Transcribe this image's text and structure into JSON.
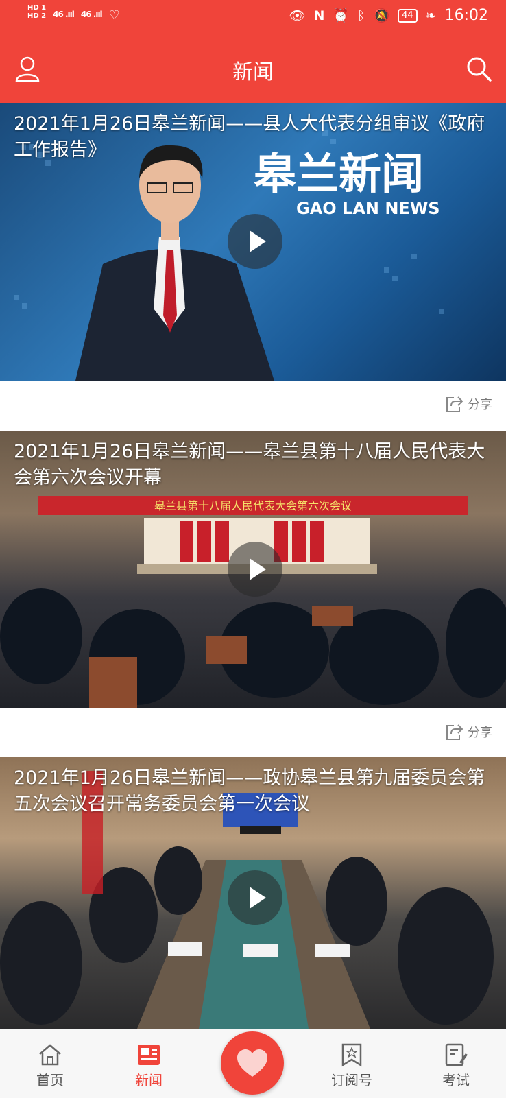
{
  "status_bar": {
    "hd1": "HD 1",
    "hd2": "HD 2",
    "signal1": "46 .ııl",
    "signal2": "46 .ııl",
    "battery": "44",
    "time": "16:02"
  },
  "header": {
    "title": "新闻",
    "user_icon": "user-icon",
    "search_icon": "search-icon"
  },
  "feed": {
    "items": [
      {
        "title": "2021年1月26日皋兰新闻——县人大代表分组审议《政府工作报告》",
        "share_label": "分享"
      },
      {
        "title": "2021年1月26日皋兰新闻——皋兰县第十八届人民代表大会第六次会议开幕",
        "share_label": "分享"
      },
      {
        "title": "2021年1月26日皋兰新闻——政协皋兰县第九届委员会第五次会议召开常务委员会第一次会议"
      }
    ],
    "banner_text": "皋兰新闻",
    "banner_sub": "GAO LAN NEWS",
    "hall_banner": "皋兰县第十八届人民代表大会第六次会议"
  },
  "tabbar": {
    "tabs": [
      {
        "label": "首页",
        "icon": "home-icon"
      },
      {
        "label": "新闻",
        "icon": "news-icon",
        "active": true
      },
      {
        "label": "订阅号",
        "icon": "subscribe-icon"
      },
      {
        "label": "考试",
        "icon": "exam-icon"
      }
    ],
    "fab_icon": "heart-icon"
  },
  "colors": {
    "accent": "#f0443a"
  }
}
